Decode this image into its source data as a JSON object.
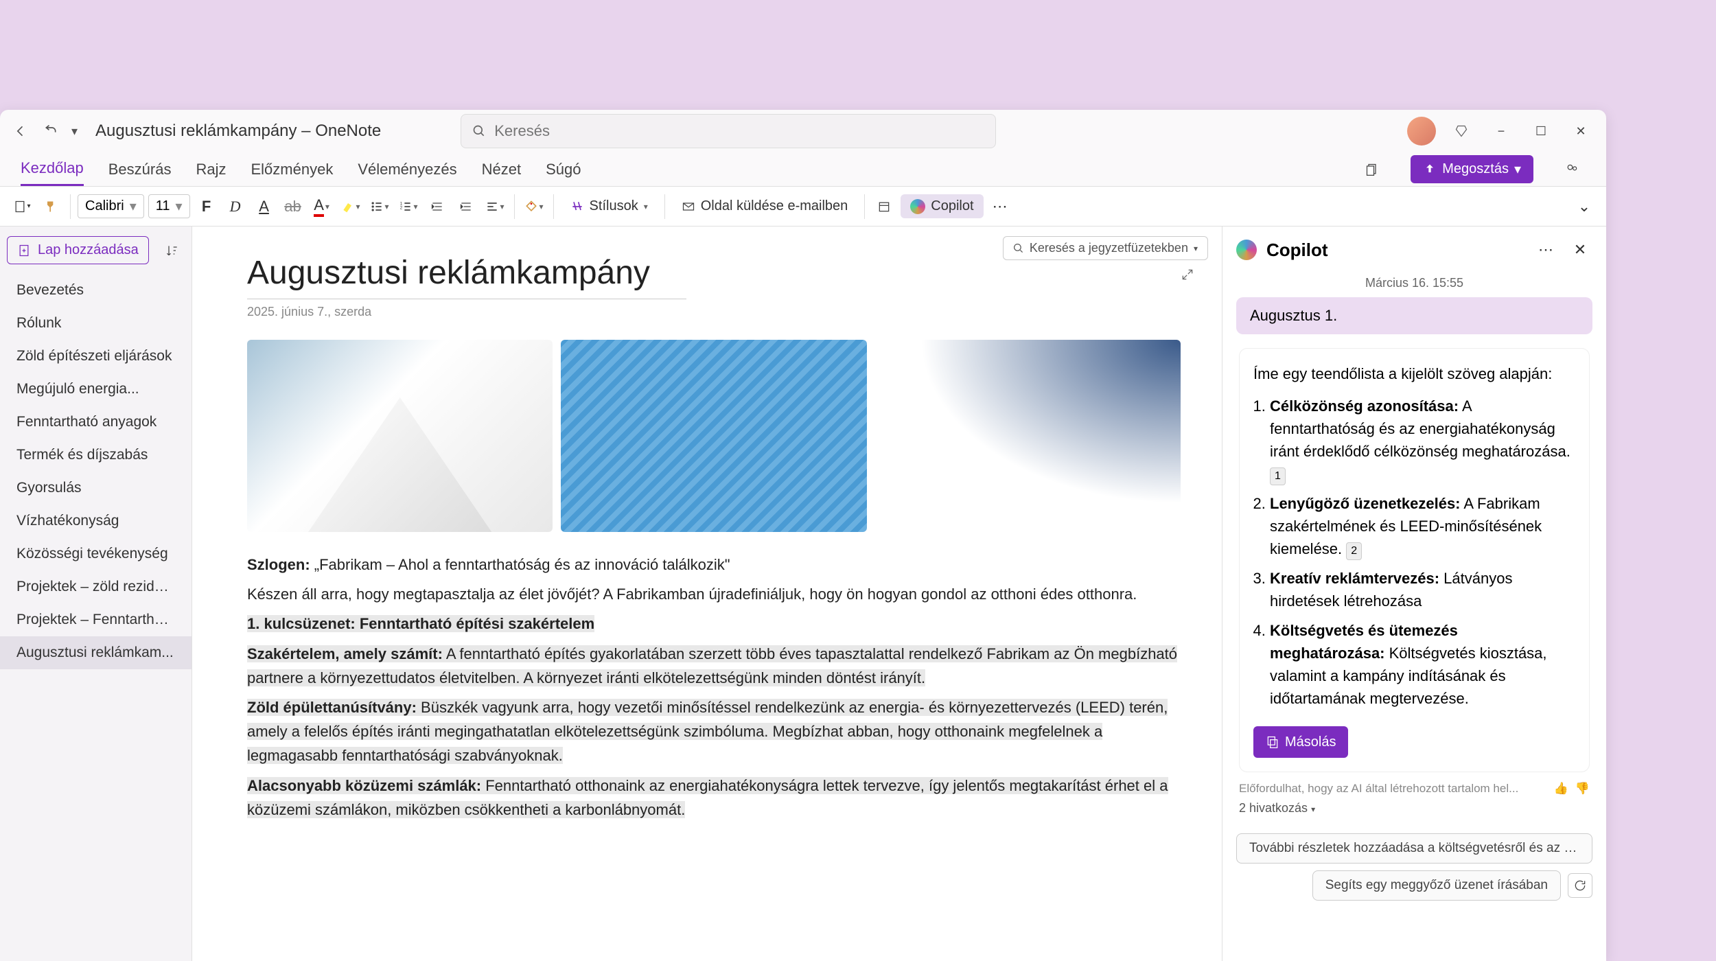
{
  "app": {
    "title": "Augusztusi reklámkampány – OneNote",
    "search_placeholder": "Keresés"
  },
  "window_controls": {
    "minimize": "−",
    "maximize": "☐",
    "close": "✕"
  },
  "tabs": {
    "items": [
      "Kezdőlap",
      "Beszúrás",
      "Rajz",
      "Előzmények",
      "Véleményezés",
      "Nézet",
      "Súgó"
    ],
    "active_index": 0,
    "share_label": "Megosztás"
  },
  "ribbon": {
    "font_name": "Calibri",
    "font_size": "11",
    "styles_label": "Stílusok",
    "email_label": "Oldal küldése e-mailben",
    "copilot_label": "Copilot"
  },
  "notebook_search": "Keresés a jegyzetfüzetekben",
  "sidebar": {
    "add_page_label": "Lap hozzáadása",
    "items": [
      "Bevezetés",
      "Rólunk",
      "Zöld építészeti eljárások",
      "Megújuló energia...",
      "Fenntartható anyagok",
      "Termék és díjszabás",
      "Gyorsulás",
      "Vízhatékonyság",
      "Közösségi tevékenység",
      "Projektek – zöld rezidens...",
      "Projektek – Fenntartható...",
      "Augusztusi reklámkam..."
    ],
    "active_index": 11
  },
  "page": {
    "title": "Augusztusi reklámkampány",
    "date": "2025. június 7., szerda",
    "slogan_label": "Szlogen:",
    "slogan": "„Fabrikam – Ahol a fenntarthatóság és az innováció találkozik\"",
    "intro": "Készen áll arra, hogy megtapasztalja az élet jövőjét? A Fabrikamban újradefiniáljuk, hogy ön hogyan gondol az otthoni édes otthonra.",
    "key1_title": "1. kulcsüzenet: Fenntartható építési szakértelem",
    "p1_label": "Szakértelem, amely számít:",
    "p1_text": " A fenntartható építés gyakorlatában szerzett több éves tapasztalattal rendelkező Fabrikam az Ön megbízható partnere a környezettudatos életvitelben. A környezet iránti elkötelezettségünk minden döntést irányít.",
    "p2_label": "Zöld épülettanúsítvány:",
    "p2_text": " Büszkék vagyunk arra, hogy vezetői minősítéssel rendelkezünk az energia- és környezettervezés (LEED) terén, amely a felelős építés iránti megingathatatlan elkötelezettségünk szimbóluma. Megbízhat abban, hogy otthonaink megfelelnek a legmagasabb fenntarthatósági szabványoknak.",
    "p3_label": "Alacsonyabb közüzemi számlák:",
    "p3_text": " Fenntartható otthonaink az energiahatékonyságra lettek tervezve, így jelentős megtakarítást érhet el a közüzemi számlákon, miközben csökkentheti a karbonlábnyomát."
  },
  "copilot": {
    "title": "Copilot",
    "timestamp": "Március 16. 15:55",
    "user_message": "Augusztus 1.",
    "intro": "Íme egy teendőlista a kijelölt szöveg alapján:",
    "items": [
      {
        "title": "Célközönség azonosítása:",
        "text": " A fenntarthatóság és az energiahatékonyság iránt érdeklődő célközönség meghatározása.",
        "badge": "1"
      },
      {
        "title": "Lenyűgöző üzenetkezelés:",
        "text": " A Fabrikam szakértelmének és LEED-minősítésének kiemelése.",
        "badge": "2"
      },
      {
        "title": "Kreatív reklámtervezés:",
        "text": " Látványos hirdetések létrehozása",
        "badge": ""
      },
      {
        "title": "Költségvetés és ütemezés meghatározása:",
        "text": " Költségvetés kiosztása, valamint a kampány indításának és időtartamának megtervezése.",
        "badge": ""
      }
    ],
    "copy_label": "Másolás",
    "disclaimer": "Előfordulhat, hogy az AI által létrehozott tartalom hel...",
    "references": "2 hivatkozás",
    "suggestions": [
      "További részletek hozzáadása a költségvetésről és az üte...",
      "Segíts egy meggyőző üzenet írásában"
    ]
  }
}
